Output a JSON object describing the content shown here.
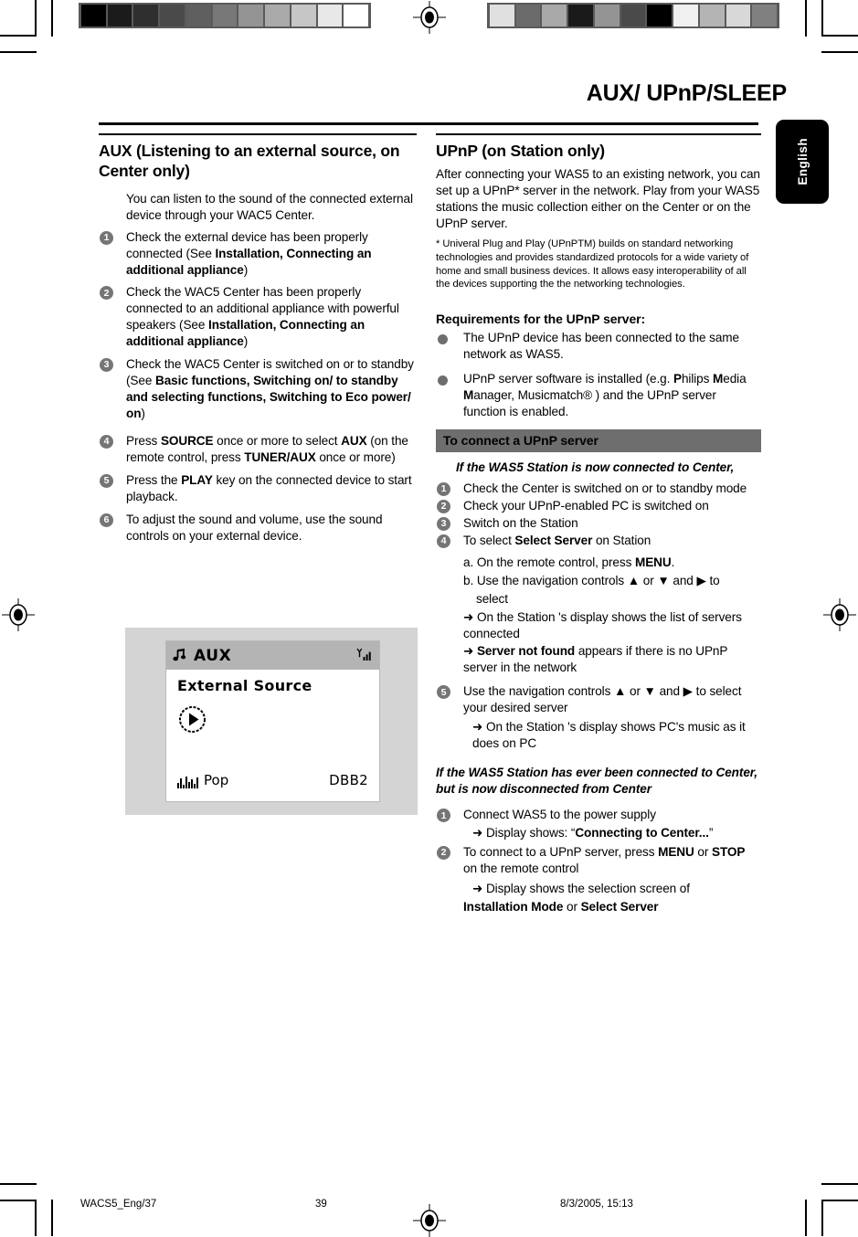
{
  "header": {
    "doc_title": "AUX/ UPnP/SLEEP",
    "language_tab": "English"
  },
  "left_column": {
    "section_title": "AUX (Listening to an external source, on Center only)",
    "intro": "You can listen to the sound of the connected external device through your WAC5 Center.",
    "steps": [
      {
        "num": "1",
        "text": "Check the external device has been properly connected (See ",
        "bold": "Installation, Connecting an additional appliance",
        "tail": ")"
      },
      {
        "num": "2",
        "text": "Check the WAC5 Center has been properly connected to an additional appliance with powerful speakers (See ",
        "bold": "Installation, Connecting an additional appliance",
        "tail": ")"
      },
      {
        "num": "3",
        "text": "Check the WAC5 Center is switched on or to standby (See ",
        "bold": "Basic functions, Switching on/ to standby and selecting functions, Switching to Eco power/ on",
        "tail": ")"
      },
      {
        "num": "4",
        "text": "Press ",
        "bold": "SOURCE",
        "mid": " once or more to select ",
        "bold2": "AUX",
        "tail2": " (on the remote control, press ",
        "bold3": "TUNER/AUX",
        "tail3": " once or more)"
      },
      {
        "num": "5",
        "text": "Press the ",
        "bold": "PLAY",
        "tail": " key on the connected device to start playback."
      },
      {
        "num": "6",
        "text": "To adjust the sound and volume, use the sound controls on your external device."
      }
    ],
    "lcd": {
      "title": "AUX",
      "source": "External Source",
      "mode": "Pop",
      "dbb": "DBB2",
      "note_icon": "music-note-icon",
      "signal_icon": "signal-strength-icon",
      "play_icon": "play-button-icon",
      "eq_icon": "equalizer-icon"
    }
  },
  "right_column": {
    "section_title": "UPnP (on Station only)",
    "intro": "After connecting your WAS5 to an existing network, you can set up a UPnP* server in the network.  Play from your WAS5 stations the music collection either on the Center or on the UPnP server.",
    "footnote": "* Univeral Plug and Play (UPnPTM) builds on standard networking technologies and provides standardized protocols for a wide variety of home and small business devices. It allows easy interoperability of all the devices supporting the the networking technologies.",
    "requirements_heading": "Requirements for the UPnP server:",
    "requirements": [
      {
        "text": "The UPnP device has been connected to the same network as WAS5."
      },
      {
        "text": "UPnP server software is installed (e.g. ",
        "b1": "P",
        "t1": "hilips ",
        "b2": "M",
        "t2": "edia ",
        "b3": "M",
        "t3": "anager, Musicmatch® ) and the UPnP server function is enabled."
      }
    ],
    "gray_bar": "To connect a UPnP server",
    "case1_heading": "If the WAS5 Station is now connected to Center,",
    "case1_steps": [
      {
        "num": "1",
        "text": "Check the Center is switched on or to standby mode"
      },
      {
        "num": "2",
        "text": " Check your UPnP-enabled PC is switched on"
      },
      {
        "num": "3",
        "text": "Switch on the Station"
      },
      {
        "num": "4",
        "text": "To select ",
        "bold": "Select Server",
        "tail": " on Station"
      }
    ],
    "case1_sub_a": "a. On the remote control, press ",
    "case1_sub_a_bold": "MENU",
    "case1_sub_a_tail": ".",
    "case1_sub_b": "b. Use the navigation controls ▲  or  ▼  and ▶ to",
    "case1_sub_b2": "select",
    "case1_arrow1": "➜ On the Station 's display shows the list of servers connected",
    "case1_arrow2_bold": "Server not found",
    "case1_arrow2_tail": " appears if there is no UPnP server in the network",
    "case1_step5_num": "5",
    "case1_step5": "  Use the navigation controls ▲  or  ▼  and ▶ to select  your desired server",
    "case1_step5_arrow": "➜ On the Station 's display shows PC's music as it does on PC",
    "case2_heading": "If the WAS5 Station has ever been connected to Center, but is now disconnected from Center",
    "case2_steps": [
      {
        "num": "1",
        "text": "Connect  WAS5 to the power supply"
      },
      {
        "num": "2",
        "text": "To connect to a UPnP server, press ",
        "bold": "MENU",
        "mid": " or ",
        "bold2": "STOP",
        "tail": " on the remote control"
      }
    ],
    "case2_arrow1_pre": "➜ Display shows: “",
    "case2_arrow1_bold": "Connecting to Center...",
    "case2_arrow1_post": "”",
    "case2_arrow2_pre": "➜ Display shows the selection screen of ",
    "case2_arrow2_bold1": "Installation Mode",
    "case2_arrow2_mid": " or ",
    "case2_arrow2_bold2": "Select Server"
  },
  "footer": {
    "file": "WACS5_Eng/37",
    "page": "39",
    "date": "8/3/2005, 15:13"
  },
  "calibration": {
    "left_swatches": [
      "#000000",
      "#1b1b1b",
      "#2f2f2f",
      "#4a4a4a",
      "#5f5f5f",
      "#787878",
      "#949494",
      "#aaaaaa",
      "#c6c6c6",
      "#e8e8e8",
      "#ffffff"
    ],
    "right_swatches": [
      "#e0e0e0",
      "#6b6b6b",
      "#a8a8a8",
      "#1a1a1a",
      "#949494",
      "#4a4a4a",
      "#000000",
      "#f0f0f0",
      "#b4b4b4",
      "#d8d8d8",
      "#808080"
    ]
  }
}
